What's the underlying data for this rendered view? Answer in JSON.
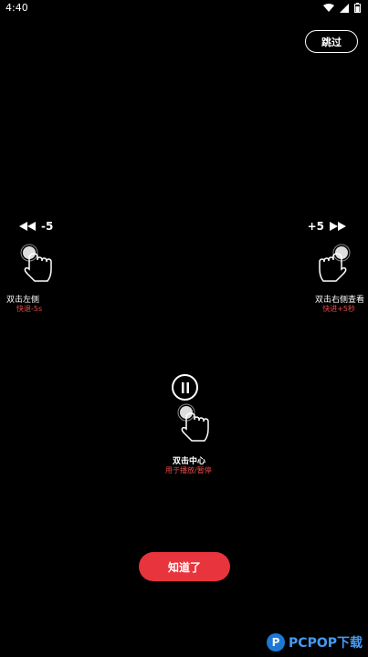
{
  "status": {
    "time": "4:40"
  },
  "skip": {
    "label": "跳过"
  },
  "left": {
    "label": "-5",
    "title": "双击左侧",
    "sub": "快退-5s"
  },
  "right": {
    "label": "+5",
    "title": "双击右侧查看",
    "sub": "快进+5秒"
  },
  "center": {
    "title": "双击中心",
    "sub": "用于播放/暂停"
  },
  "ok": {
    "label": "知道了"
  },
  "watermark": {
    "text": "PCPOP下载"
  },
  "colors": {
    "accent": "#e8343c",
    "hint_red": "#e84a4a"
  }
}
